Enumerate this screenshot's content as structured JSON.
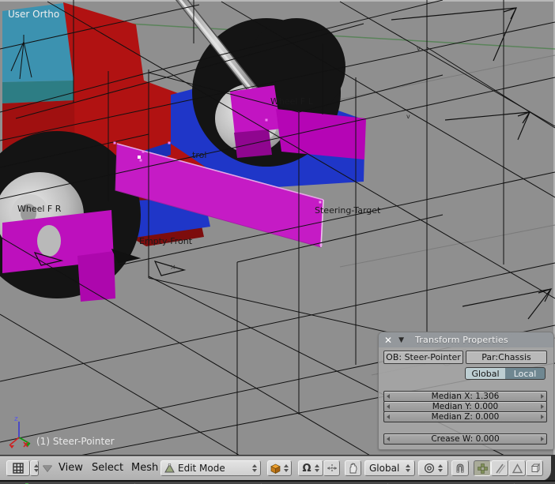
{
  "window": {
    "view_label": "User Ortho",
    "status_text": "(1) Steer-Pointer"
  },
  "scene_labels": {
    "wheel_fl": "Wheel F L",
    "wheel_fr": "Wheel F R",
    "steering_target": "Steering-Target",
    "empty_front": "Empty-Front",
    "partial_control": "trol",
    "axis_z": "z",
    "tick_v1": "v",
    "tick_v2": "v",
    "tick_star": "×"
  },
  "transform_panel": {
    "title": "Transform Properties",
    "close_glyph": "✕",
    "collapse_glyph": "▼",
    "ob_field": "OB: Steer-Pointer",
    "par_field": "Par:Chassis",
    "global_button": "Global",
    "local_button": "Local",
    "median_x": "Median X: 1.306",
    "median_y": "Median Y: 0.000",
    "median_z": "Median Z: 0.000",
    "crease_w": "Crease W: 0.000"
  },
  "header": {
    "menus": [
      "View",
      "Select",
      "Mesh"
    ],
    "mode_dropdown": "Edit Mode",
    "orientation_dropdown": "Global",
    "pivot_glyph": "Ω"
  },
  "colors": {
    "viewport_bg": "#8f8f8f",
    "header_bg": "#b3b3b3",
    "panel_bg": "#a7a7a7",
    "cab_red": "#b11212",
    "body_blue": "#1f36c8",
    "window_cyan": "#3c92b0",
    "steer_magenta": "#c214c2",
    "tire_black": "#141414",
    "global_selected": "#bdced2",
    "local_unselected": "#6f8791"
  }
}
